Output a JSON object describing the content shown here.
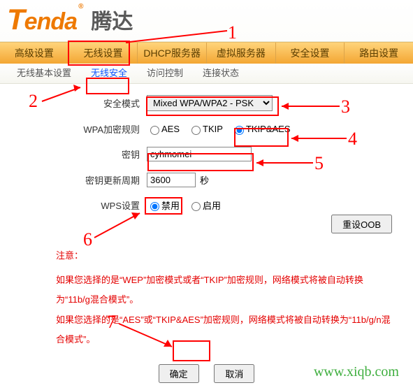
{
  "brand": {
    "name": "Tenda",
    "reg": "®",
    "cn": "腾达"
  },
  "nav": [
    "高级设置",
    "无线设置",
    "DHCP服务器",
    "虚拟服务器",
    "安全设置",
    "路由设置"
  ],
  "subnav": [
    "无线基本设置",
    "无线安全",
    "访问控制",
    "连接状态"
  ],
  "subnav_active_index": 1,
  "form": {
    "security_mode": {
      "label": "安全模式",
      "value": "Mixed WPA/WPA2 - PSK"
    },
    "wpa_rule": {
      "label": "WPA加密规则",
      "options": [
        "AES",
        "TKIP",
        "TKIP&AES"
      ],
      "selected_index": 2
    },
    "key": {
      "label": "密钥",
      "value": "cyhmomei"
    },
    "renew": {
      "label": "密钥更新周期",
      "value": "3600",
      "unit": "秒"
    },
    "wps": {
      "label": "WPS设置",
      "options": [
        "禁用",
        "启用"
      ],
      "selected_index": 0
    },
    "reset_btn": "重设OOB"
  },
  "notes": {
    "title": "注意：",
    "p1": "如果您选择的是“WEP”加密模式或者“TKIP”加密规则，网络模式将被自动转换为“11b/g混合模式”。",
    "p2": "如果您选择的是“AES”或“TKIP&AES”加密规则，网络模式将被自动转换为“11b/g/n混合模式”。"
  },
  "buttons": {
    "ok": "确定",
    "cancel": "取消"
  },
  "watermark": "www.xiqb.com",
  "annotations": {
    "n1": "1",
    "n2": "2",
    "n3": "3",
    "n4": "4",
    "n5": "5",
    "n6": "6",
    "n7": "7"
  }
}
